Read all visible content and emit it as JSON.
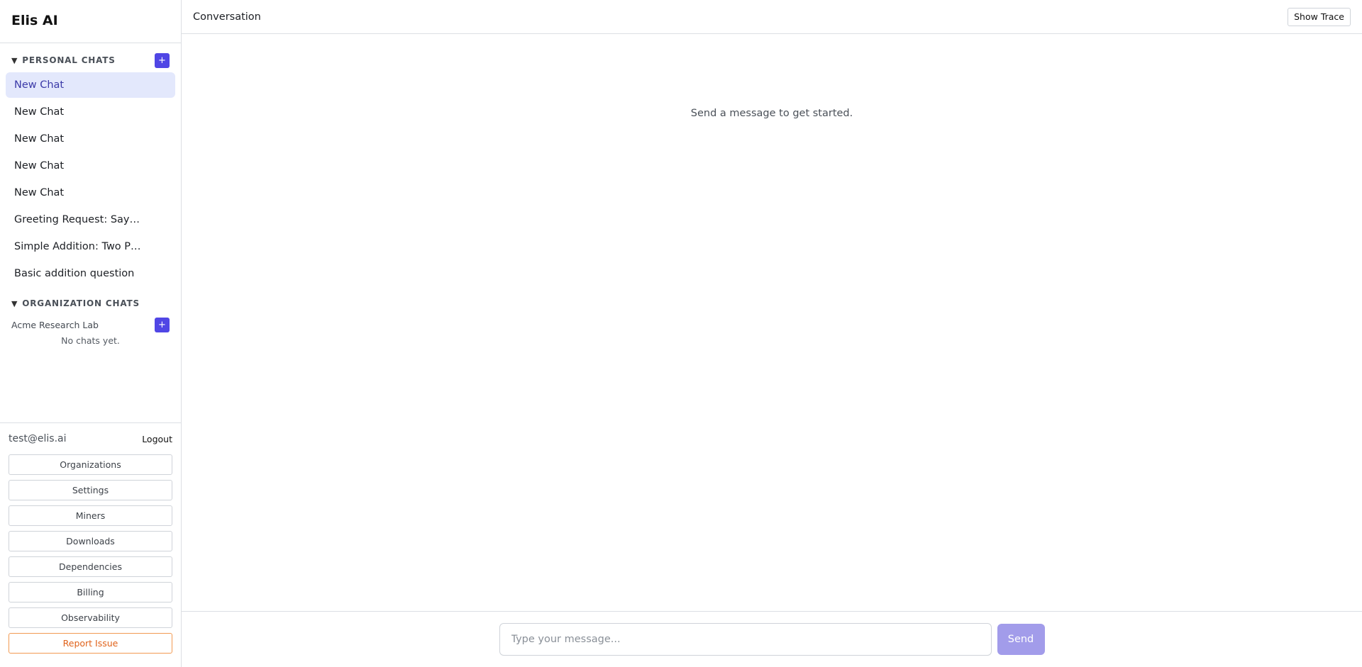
{
  "app": {
    "title": "Elis AI"
  },
  "sidebar": {
    "personal": {
      "caret": "▼",
      "title": "Personal Chats",
      "add_label": "+",
      "chats": [
        {
          "label": "New Chat",
          "active": true
        },
        {
          "label": "New Chat"
        },
        {
          "label": "New Chat"
        },
        {
          "label": "New Chat"
        },
        {
          "label": "New Chat"
        },
        {
          "label": "Greeting Request: Say …"
        },
        {
          "label": "Simple Addition: Two Pl…"
        },
        {
          "label": "Basic addition question"
        }
      ]
    },
    "organization": {
      "caret": "▼",
      "title": "Organization Chats",
      "org_name": "Acme Research Lab",
      "add_label": "+",
      "empty_text": "No chats yet."
    },
    "footer": {
      "email": "test@elis.ai",
      "logout_label": "Logout",
      "buttons": [
        "Organizations",
        "Settings",
        "Miners",
        "Downloads",
        "Dependencies",
        "Billing",
        "Observability"
      ],
      "report_label": "Report Issue"
    }
  },
  "header": {
    "title": "Conversation",
    "trace_label": "Show Trace"
  },
  "conversation": {
    "empty_text": "Send a message to get started."
  },
  "composer": {
    "placeholder": "Type your message...",
    "value": "",
    "send_label": "Send"
  },
  "colors": {
    "accent": "#5046e5",
    "active_bg": "#e3e8fc",
    "send_disabled": "#a29cea",
    "report": "#e0621a"
  }
}
